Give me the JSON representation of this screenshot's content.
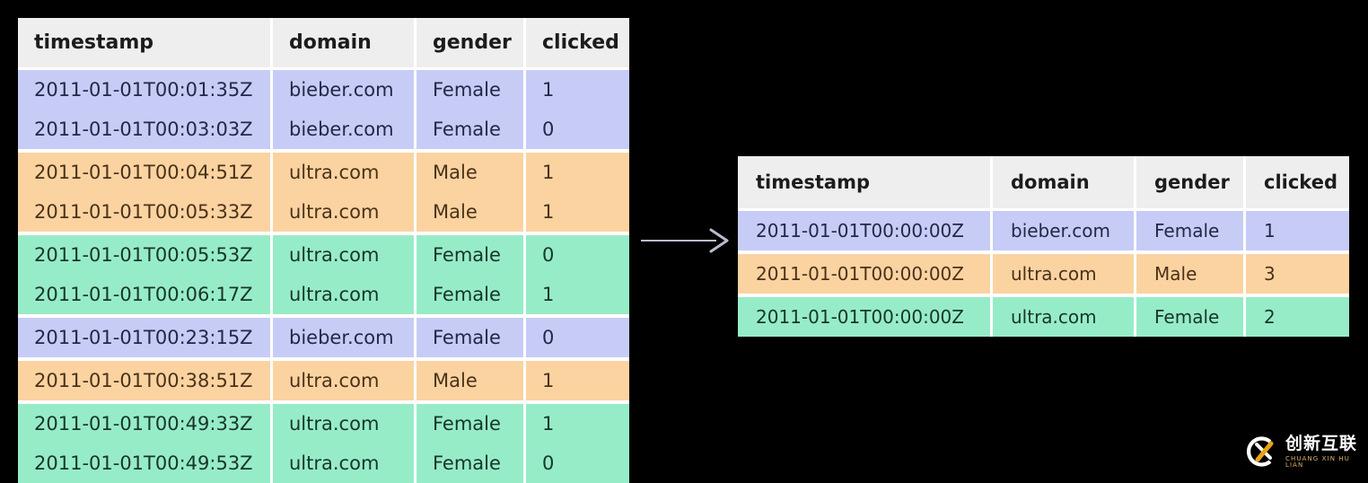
{
  "background_color": "#000000",
  "palette": {
    "header_bg": "#eeeeee",
    "header_text": "#1c1c1c",
    "group_lavender": "#c7ccf7",
    "group_orange": "#fbd3a1",
    "group_green": "#97ecc8",
    "grid_line": "#ffffff",
    "arrow": "#b9bcd0"
  },
  "source_table": {
    "columns": [
      "timestamp",
      "domain",
      "gender",
      "clicked"
    ],
    "rows": [
      {
        "group": "lavender",
        "group_start": true,
        "timestamp": "2011-01-01T00:01:35Z",
        "domain": "bieber.com",
        "gender": "Female",
        "clicked": "1"
      },
      {
        "group": "lavender",
        "group_start": false,
        "timestamp": "2011-01-01T00:03:03Z",
        "domain": "bieber.com",
        "gender": "Female",
        "clicked": "0"
      },
      {
        "group": "orange",
        "group_start": true,
        "timestamp": "2011-01-01T00:04:51Z",
        "domain": "ultra.com",
        "gender": "Male",
        "clicked": "1"
      },
      {
        "group": "orange",
        "group_start": false,
        "timestamp": "2011-01-01T00:05:33Z",
        "domain": "ultra.com",
        "gender": "Male",
        "clicked": "1"
      },
      {
        "group": "green",
        "group_start": true,
        "timestamp": "2011-01-01T00:05:53Z",
        "domain": "ultra.com",
        "gender": "Female",
        "clicked": "0"
      },
      {
        "group": "green",
        "group_start": false,
        "timestamp": "2011-01-01T00:06:17Z",
        "domain": "ultra.com",
        "gender": "Female",
        "clicked": "1"
      },
      {
        "group": "lavender",
        "group_start": true,
        "timestamp": "2011-01-01T00:23:15Z",
        "domain": "bieber.com",
        "gender": "Female",
        "clicked": "0"
      },
      {
        "group": "orange",
        "group_start": true,
        "timestamp": "2011-01-01T00:38:51Z",
        "domain": "ultra.com",
        "gender": "Male",
        "clicked": "1"
      },
      {
        "group": "green",
        "group_start": true,
        "timestamp": "2011-01-01T00:49:33Z",
        "domain": "ultra.com",
        "gender": "Female",
        "clicked": "1"
      },
      {
        "group": "green",
        "group_start": false,
        "timestamp": "2011-01-01T00:49:53Z",
        "domain": "ultra.com",
        "gender": "Female",
        "clicked": "0"
      }
    ]
  },
  "result_table": {
    "columns": [
      "timestamp",
      "domain",
      "gender",
      "clicked"
    ],
    "rows": [
      {
        "group": "lavender",
        "group_start": true,
        "timestamp": "2011-01-01T00:00:00Z",
        "domain": "bieber.com",
        "gender": "Female",
        "clicked": "1"
      },
      {
        "group": "orange",
        "group_start": true,
        "timestamp": "2011-01-01T00:00:00Z",
        "domain": "ultra.com",
        "gender": "Male",
        "clicked": "3"
      },
      {
        "group": "green",
        "group_start": true,
        "timestamp": "2011-01-01T00:00:00Z",
        "domain": "ultra.com",
        "gender": "Female",
        "clicked": "2"
      }
    ]
  },
  "arrow": {
    "icon": "arrow-right-icon",
    "direction": "right"
  },
  "watermark": {
    "logo_letters": "CX",
    "chinese": "创新互联",
    "pinyin": "CHUANG XIN HU LIAN"
  }
}
